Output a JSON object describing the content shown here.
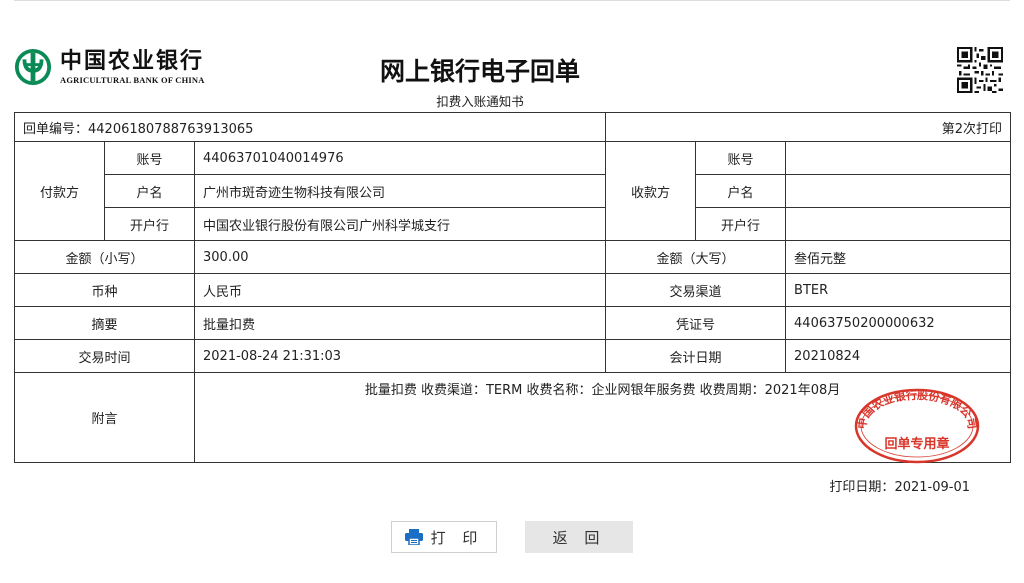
{
  "bank": {
    "name_cn": "中国农业银行",
    "name_en": "AGRICULTURAL BANK OF CHINA",
    "brand_color": "#0a8a55"
  },
  "document": {
    "title": "网上银行电子回单",
    "subtitle": "扣费入账通知书",
    "receipt_no_label": "回单编号：",
    "receipt_no": "44206180788763913065",
    "print_count": "第2次打印"
  },
  "payer": {
    "section_label": "付款方",
    "account_label": "账号",
    "account": "44063701040014976",
    "name_label": "户名",
    "name": "广州市斑奇迹生物科技有限公司",
    "bank_label": "开户行",
    "bank": "中国农业银行股份有限公司广州科学城支行"
  },
  "payee": {
    "section_label": "收款方",
    "account_label": "账号",
    "account": "",
    "name_label": "户名",
    "name": "",
    "bank_label": "开户行",
    "bank": ""
  },
  "details": {
    "amount_small_label": "金额（小写）",
    "amount_small": "300.00",
    "amount_big_label": "金额（大写）",
    "amount_big": "叁佰元整",
    "currency_label": "币种",
    "currency": "人民币",
    "channel_label": "交易渠道",
    "channel": "BTER",
    "summary_label": "摘要",
    "summary": "批量扣费",
    "voucher_label": "凭证号",
    "voucher": "44063750200000632",
    "time_label": "交易时间",
    "time": "2021-08-24 21:31:03",
    "acct_date_label": "会计日期",
    "acct_date": "20210824",
    "note_label": "附言",
    "note": "批量扣费 收费渠道：TERM 收费名称：企业网银年服务费 收费周期：2021年08月"
  },
  "seal": {
    "top_text": "中国农业银行股份有限公司",
    "bottom_text": "回单专用章",
    "color": "#d9362b"
  },
  "footer": {
    "print_date_label": "打印日期：",
    "print_date": "2021-09-01"
  },
  "buttons": {
    "print": "打 印",
    "back": "返 回"
  }
}
